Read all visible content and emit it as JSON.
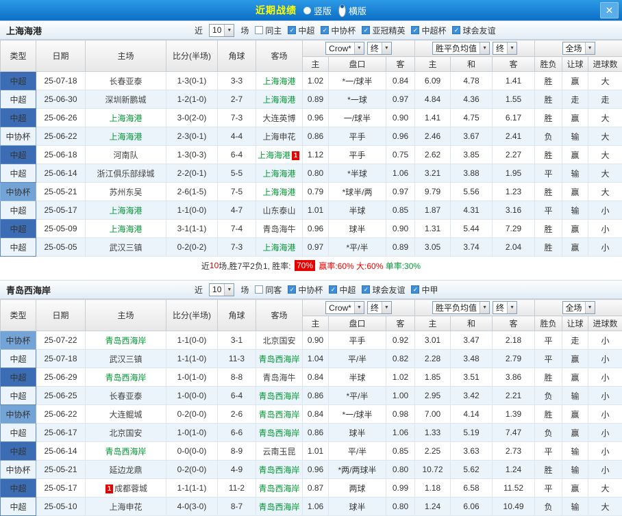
{
  "colors": {
    "topbar_blue": "#1583d6",
    "title_yellow": "#ffff00",
    "type_csl_blue": "#3c6db4",
    "type_cup_blue": "#74a3d6",
    "focus_team_green": "#009933",
    "score_red": "#e60000",
    "win_red": "#e60000",
    "draw_blue": "#1565d8",
    "loss_green": "#009933"
  },
  "topbar": {
    "title": "近期战绩",
    "layout_options": [
      {
        "label": "竖版",
        "selected": false
      },
      {
        "label": "横版",
        "selected": true
      }
    ],
    "close_label": "✕"
  },
  "filter_labels": {
    "near": "近",
    "games": "场"
  },
  "table_header": {
    "fixed_cols": [
      "类型",
      "日期",
      "主场",
      "比分(半场)",
      "角球",
      "客场"
    ],
    "odds_group": {
      "selects": [
        "Crow*",
        "终"
      ],
      "subcols": [
        "主",
        "盘口",
        "客"
      ]
    },
    "europe_group": {
      "selects": [
        "胜平负均值",
        "终"
      ],
      "subcols": [
        "主",
        "和",
        "客"
      ]
    },
    "result_group": {
      "selects": [
        "全场"
      ],
      "subcols": [
        "胜负",
        "让球",
        "进球数"
      ]
    }
  },
  "sections": [
    {
      "team": "上海海港",
      "match_count": "10",
      "filters": [
        {
          "label": "同主",
          "checked": false
        },
        {
          "label": "中超",
          "checked": true
        },
        {
          "label": "中协杯",
          "checked": true
        },
        {
          "label": "亚冠精英",
          "checked": true
        },
        {
          "label": "中超杯",
          "checked": true
        },
        {
          "label": "球会友谊",
          "checked": true
        }
      ],
      "rows": [
        {
          "type": "中超",
          "date": "25-07-18",
          "home": {
            "name": "长春亚泰",
            "focus": false
          },
          "score": "1-3(0-1)",
          "corner": "3-3",
          "away": {
            "name": "上海海港",
            "focus": true
          },
          "o1": "1.02",
          "hc": "*一/球半",
          "o2": "0.84",
          "w": "6.09",
          "dr": "4.78",
          "l": "1.41",
          "res": "胜",
          "hres": "赢",
          "gres": "大"
        },
        {
          "type": "中超",
          "date": "25-06-30",
          "home": {
            "name": "深圳新鹏城",
            "focus": false
          },
          "score": "1-2(1-0)",
          "corner": "2-7",
          "away": {
            "name": "上海海港",
            "focus": true
          },
          "o1": "0.89",
          "hc": "*一球",
          "o2": "0.97",
          "w": "4.84",
          "dr": "4.36",
          "l": "1.55",
          "res": "胜",
          "hres": "走",
          "gres": "走"
        },
        {
          "type": "中超",
          "date": "25-06-26",
          "home": {
            "name": "上海海港",
            "focus": true
          },
          "score": "3-0(2-0)",
          "corner": "7-3",
          "away": {
            "name": "大连英博",
            "focus": false
          },
          "o1": "0.96",
          "hc": "一/球半",
          "o2": "0.90",
          "w": "1.41",
          "dr": "4.75",
          "l": "6.17",
          "res": "胜",
          "hres": "赢",
          "gres": "大"
        },
        {
          "type": "中协杯",
          "date": "25-06-22",
          "home": {
            "name": "上海海港",
            "focus": true
          },
          "score": "2-3(0-1)",
          "corner": "4-4",
          "away": {
            "name": "上海申花",
            "focus": false
          },
          "o1": "0.86",
          "hc": "平手",
          "o2": "0.96",
          "w": "2.46",
          "dr": "3.67",
          "l": "2.41",
          "res": "负",
          "hres": "输",
          "gres": "大"
        },
        {
          "type": "中超",
          "date": "25-06-18",
          "home": {
            "name": "河南队",
            "focus": false
          },
          "score": "1-3(0-3)",
          "corner": "6-4",
          "away": {
            "name": "上海海港",
            "focus": true,
            "card": "1",
            "card_pos": "after"
          },
          "o1": "1.12",
          "hc": "平手",
          "o2": "0.75",
          "w": "2.62",
          "dr": "3.85",
          "l": "2.27",
          "res": "胜",
          "hres": "赢",
          "gres": "大"
        },
        {
          "type": "中超",
          "date": "25-06-14",
          "home": {
            "name": "浙江俱乐部绿城",
            "focus": false
          },
          "score": "2-2(0-1)",
          "corner": "5-5",
          "away": {
            "name": "上海海港",
            "focus": true
          },
          "o1": "0.80",
          "hc": "*半球",
          "o2": "1.06",
          "w": "3.21",
          "dr": "3.88",
          "l": "1.95",
          "res": "平",
          "hres": "输",
          "gres": "大"
        },
        {
          "type": "中协杯",
          "date": "25-05-21",
          "home": {
            "name": "苏州东吴",
            "focus": false
          },
          "score": "2-6(1-5)",
          "corner": "7-5",
          "away": {
            "name": "上海海港",
            "focus": true
          },
          "o1": "0.79",
          "hc": "*球半/两",
          "o2": "0.97",
          "w": "9.79",
          "dr": "5.56",
          "l": "1.23",
          "res": "胜",
          "hres": "赢",
          "gres": "大"
        },
        {
          "type": "中超",
          "date": "25-05-17",
          "home": {
            "name": "上海海港",
            "focus": true
          },
          "score": "1-1(0-0)",
          "corner": "4-7",
          "away": {
            "name": "山东泰山",
            "focus": false
          },
          "o1": "1.01",
          "hc": "半球",
          "o2": "0.85",
          "w": "1.87",
          "dr": "4.31",
          "l": "3.16",
          "res": "平",
          "hres": "输",
          "gres": "小"
        },
        {
          "type": "中超",
          "date": "25-05-09",
          "home": {
            "name": "上海海港",
            "focus": true
          },
          "score": "3-1(1-1)",
          "corner": "7-4",
          "away": {
            "name": "青岛海牛",
            "focus": false
          },
          "o1": "0.96",
          "hc": "球半",
          "o2": "0.90",
          "w": "1.31",
          "dr": "5.44",
          "l": "7.29",
          "res": "胜",
          "hres": "赢",
          "gres": "小"
        },
        {
          "type": "中超",
          "date": "25-05-05",
          "home": {
            "name": "武汉三镇",
            "focus": false
          },
          "score": "0-2(0-2)",
          "corner": "7-3",
          "away": {
            "name": "上海海港",
            "focus": true
          },
          "o1": "0.97",
          "hc": "*平/半",
          "o2": "0.89",
          "w": "3.05",
          "dr": "3.74",
          "l": "2.04",
          "res": "胜",
          "hres": "赢",
          "gres": "小"
        }
      ],
      "summary": [
        {
          "text": "近",
          "style": "plain"
        },
        {
          "text": "10",
          "style": "red"
        },
        {
          "text": "场,胜7平2负1, 胜率: ",
          "style": "plain"
        },
        {
          "text": "70%",
          "style": "badge"
        },
        {
          "text": " 赢率:60%",
          "style": "red"
        },
        {
          "text": " 大:60%",
          "style": "red"
        },
        {
          "text": " 单率:30%",
          "style": "green"
        }
      ]
    },
    {
      "team": "青岛西海岸",
      "match_count": "10",
      "filters": [
        {
          "label": "同客",
          "checked": false
        },
        {
          "label": "中协杯",
          "checked": true
        },
        {
          "label": "中超",
          "checked": true
        },
        {
          "label": "球会友谊",
          "checked": true
        },
        {
          "label": "中甲",
          "checked": true
        }
      ],
      "rows": [
        {
          "type": "中协杯",
          "date": "25-07-22",
          "home": {
            "name": "青岛西海岸",
            "focus": true
          },
          "score": "1-1(0-0)",
          "corner": "3-1",
          "away": {
            "name": "北京国安",
            "focus": false
          },
          "o1": "0.90",
          "hc": "平手",
          "o2": "0.92",
          "w": "3.01",
          "dr": "3.47",
          "l": "2.18",
          "res": "平",
          "hres": "走",
          "gres": "小"
        },
        {
          "type": "中超",
          "date": "25-07-18",
          "home": {
            "name": "武汉三镇",
            "focus": false
          },
          "score": "1-1(1-0)",
          "corner": "11-3",
          "away": {
            "name": "青岛西海岸",
            "focus": true
          },
          "o1": "1.04",
          "hc": "平/半",
          "o2": "0.82",
          "w": "2.28",
          "dr": "3.48",
          "l": "2.79",
          "res": "平",
          "hres": "赢",
          "gres": "小"
        },
        {
          "type": "中超",
          "date": "25-06-29",
          "home": {
            "name": "青岛西海岸",
            "focus": true
          },
          "score": "1-0(1-0)",
          "corner": "8-8",
          "away": {
            "name": "青岛海牛",
            "focus": false
          },
          "o1": "0.84",
          "hc": "半球",
          "o2": "1.02",
          "w": "1.85",
          "dr": "3.51",
          "l": "3.86",
          "res": "胜",
          "hres": "赢",
          "gres": "小"
        },
        {
          "type": "中超",
          "date": "25-06-25",
          "home": {
            "name": "长春亚泰",
            "focus": false
          },
          "score": "1-0(0-0)",
          "corner": "6-4",
          "away": {
            "name": "青岛西海岸",
            "focus": true
          },
          "o1": "0.86",
          "hc": "*平/半",
          "o2": "1.00",
          "w": "2.95",
          "dr": "3.42",
          "l": "2.21",
          "res": "负",
          "hres": "输",
          "gres": "小"
        },
        {
          "type": "中协杯",
          "date": "25-06-22",
          "home": {
            "name": "大连鲲城",
            "focus": false
          },
          "score": "0-2(0-0)",
          "corner": "2-6",
          "away": {
            "name": "青岛西海岸",
            "focus": true
          },
          "o1": "0.84",
          "hc": "*一/球半",
          "o2": "0.98",
          "w": "7.00",
          "dr": "4.14",
          "l": "1.39",
          "res": "胜",
          "hres": "赢",
          "gres": "小"
        },
        {
          "type": "中超",
          "date": "25-06-17",
          "home": {
            "name": "北京国安",
            "focus": false
          },
          "score": "1-0(1-0)",
          "corner": "6-6",
          "away": {
            "name": "青岛西海岸",
            "focus": true
          },
          "o1": "0.86",
          "hc": "球半",
          "o2": "1.06",
          "w": "1.33",
          "dr": "5.19",
          "l": "7.47",
          "res": "负",
          "hres": "赢",
          "gres": "小"
        },
        {
          "type": "中超",
          "date": "25-06-14",
          "home": {
            "name": "青岛西海岸",
            "focus": true
          },
          "score": "0-0(0-0)",
          "corner": "8-9",
          "away": {
            "name": "云南玉昆",
            "focus": false
          },
          "o1": "1.01",
          "hc": "平/半",
          "o2": "0.85",
          "w": "2.25",
          "dr": "3.63",
          "l": "2.73",
          "res": "平",
          "hres": "输",
          "gres": "小"
        },
        {
          "type": "中协杯",
          "date": "25-05-21",
          "home": {
            "name": "延边龙鼎",
            "focus": false
          },
          "score": "0-2(0-0)",
          "corner": "4-9",
          "away": {
            "name": "青岛西海岸",
            "focus": true
          },
          "o1": "0.96",
          "hc": "*两/两球半",
          "o2": "0.80",
          "w": "10.72",
          "dr": "5.62",
          "l": "1.24",
          "res": "胜",
          "hres": "输",
          "gres": "小"
        },
        {
          "type": "中超",
          "date": "25-05-17",
          "home": {
            "name": "成都蓉城",
            "focus": false,
            "card": "1",
            "card_pos": "before"
          },
          "score": "1-1(1-1)",
          "corner": "11-2",
          "away": {
            "name": "青岛西海岸",
            "focus": true
          },
          "o1": "0.87",
          "hc": "两球",
          "o2": "0.99",
          "w": "1.18",
          "dr": "6.58",
          "l": "11.52",
          "res": "平",
          "hres": "赢",
          "gres": "大"
        },
        {
          "type": "中超",
          "date": "25-05-10",
          "home": {
            "name": "上海申花",
            "focus": false
          },
          "score": "4-0(3-0)",
          "corner": "8-7",
          "away": {
            "name": "青岛西海岸",
            "focus": true
          },
          "o1": "1.06",
          "hc": "球半",
          "o2": "0.80",
          "w": "1.24",
          "dr": "6.06",
          "l": "10.49",
          "res": "负",
          "hres": "输",
          "gres": "大"
        }
      ],
      "summary": null
    }
  ]
}
